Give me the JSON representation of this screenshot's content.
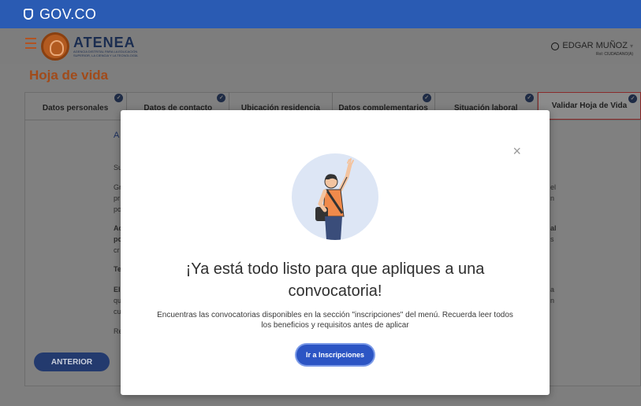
{
  "gov": {
    "brand": "GOV.CO"
  },
  "header": {
    "org_name": "ATENEA",
    "org_subtitle": "AGENCIA DISTRITAL PARA LA EDUCACIÓN SUPERIOR, LA CIENCIA Y LA TECNOLOGÍA",
    "user_name": "EDGAR MUÑOZ",
    "user_role": "Rol: CIUDADANO(A)"
  },
  "page": {
    "title": "Hoja de vida",
    "tabs": [
      {
        "label": "Datos personales",
        "completed": true
      },
      {
        "label": "Datos de contacto",
        "completed": true
      },
      {
        "label": "Ubicación residencia",
        "completed": false
      },
      {
        "label": "Datos complementarios",
        "completed": true
      },
      {
        "label": "Situación laboral",
        "completed": true
      },
      {
        "label": "Validar Hoja de Vida",
        "completed": true
      }
    ],
    "background_fragments": {
      "heading": "A",
      "l1": "Su",
      "l2": "Gr",
      "l3": "pr",
      "l4": "po",
      "l5": "Ac",
      "l6": "po",
      "l7": "cr",
      "l8": "Te",
      "l9": "El",
      "l10": "qu",
      "l11": "cu",
      "l12": "Re",
      "r1": "el",
      "r2": "n",
      "r3": "al",
      "r4": "s",
      "r5": "a",
      "r6": "n"
    },
    "back_button": "ANTERIOR"
  },
  "modal": {
    "title": "¡Ya está todo listo para que apliques a una convocatoria!",
    "text": "Encuentras las convocatorias disponibles en la sección \"inscripciones\" del menú. Recuerda leer todos los beneficios y requisitos antes de aplicar",
    "button": "Ir a Inscripciones",
    "close_symbol": "×"
  },
  "colors": {
    "gov_blue": "#2a5bb3",
    "accent_orange": "#a14b1a",
    "primary_button": "#2c55c4",
    "illustration_bg": "#dde6f5"
  }
}
